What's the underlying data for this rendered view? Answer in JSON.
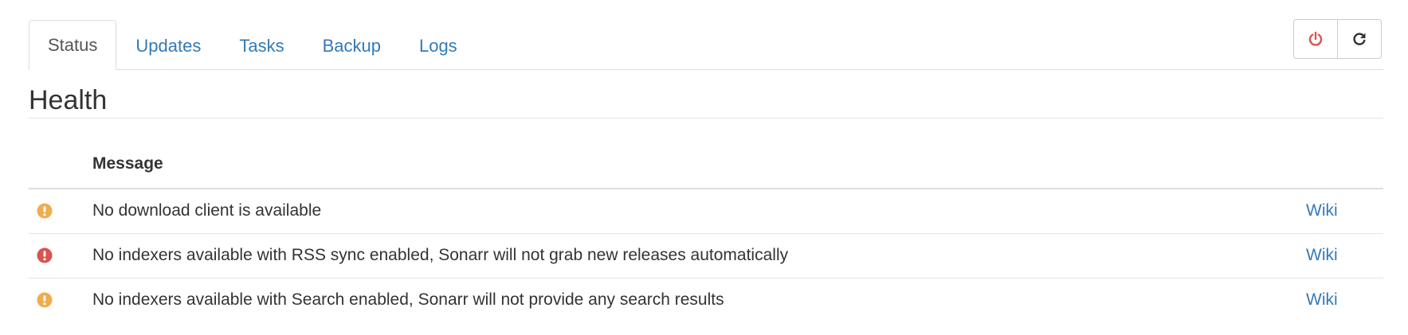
{
  "tabs": [
    {
      "label": "Status",
      "active": true
    },
    {
      "label": "Updates",
      "active": false
    },
    {
      "label": "Tasks",
      "active": false
    },
    {
      "label": "Backup",
      "active": false
    },
    {
      "label": "Logs",
      "active": false
    }
  ],
  "toolbar": {
    "restart_icon": "power-icon",
    "refresh_icon": "refresh-icon",
    "restart_color": "#d9534f",
    "refresh_color": "#333333"
  },
  "health": {
    "title": "Health",
    "column_message": "Message",
    "rows": [
      {
        "level": "warning",
        "icon": "warning-circle-icon",
        "color": "#f0ad4e",
        "message": "No download client is available",
        "link": "Wiki"
      },
      {
        "level": "error",
        "icon": "error-circle-icon",
        "color": "#d9534f",
        "message": "No indexers available with RSS sync enabled, Sonarr will not grab new releases automatically",
        "link": "Wiki"
      },
      {
        "level": "warning",
        "icon": "warning-circle-icon",
        "color": "#f0ad4e",
        "message": "No indexers available with Search enabled, Sonarr will not provide any search results",
        "link": "Wiki"
      }
    ]
  }
}
